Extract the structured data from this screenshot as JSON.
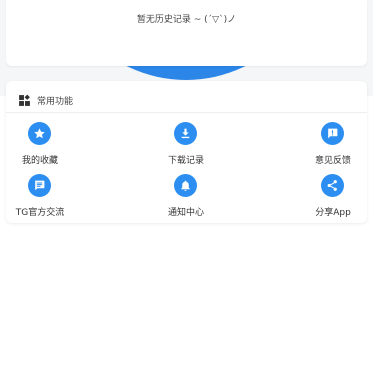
{
  "history": {
    "empty_text": "暂无历史记录 ~ (´▽`)ノ"
  },
  "common_functions": {
    "title": "常用功能",
    "header_icon": "widgets-icon",
    "items": [
      {
        "label": "我的收藏",
        "icon": "star-icon"
      },
      {
        "label": "下载记录",
        "icon": "download-icon"
      },
      {
        "label": "意见反馈",
        "icon": "feedback-icon"
      },
      {
        "label": "TG官方交流",
        "icon": "chat-icon"
      },
      {
        "label": "通知中心",
        "icon": "bell-icon"
      },
      {
        "label": "分享App",
        "icon": "share-icon"
      }
    ]
  },
  "colors": {
    "accent": "#2b8ef0",
    "header_arc": "#2b86e8"
  }
}
